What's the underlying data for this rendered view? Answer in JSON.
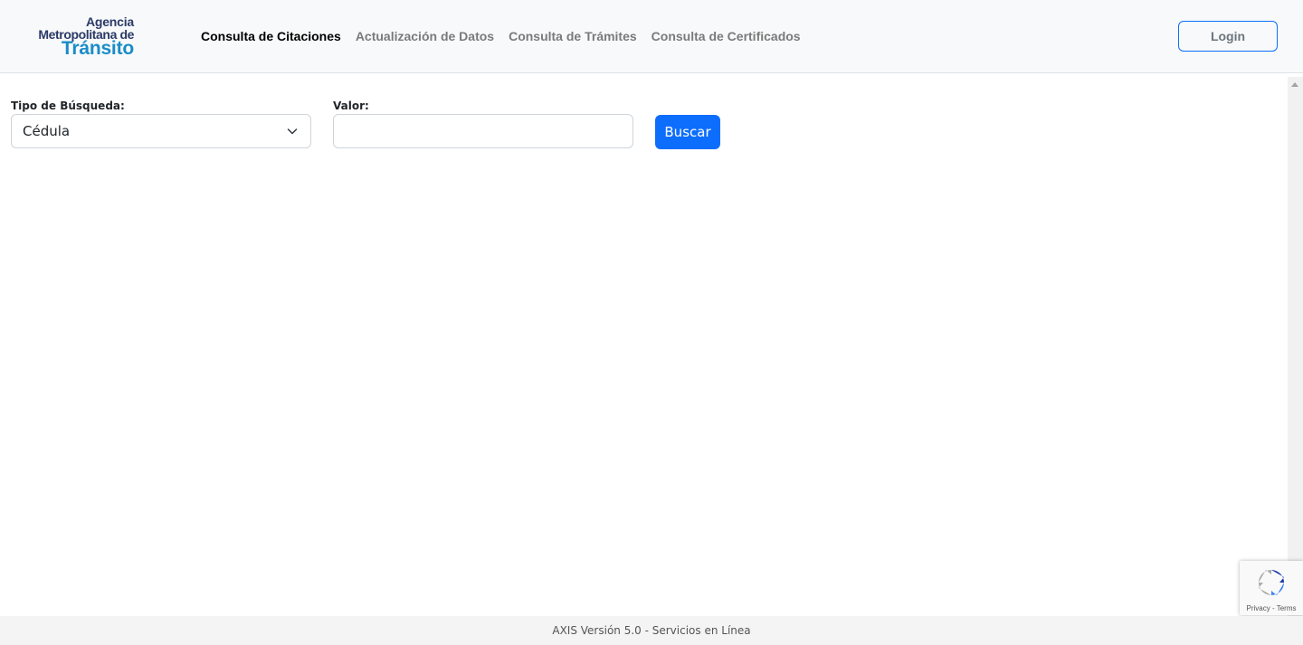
{
  "header": {
    "logo": {
      "line1": "Agencia",
      "line2": "Metropolitana de",
      "line3": "Tránsito"
    },
    "nav": [
      {
        "label": "Consulta de Citaciones",
        "active": true
      },
      {
        "label": "Actualización de Datos",
        "active": false
      },
      {
        "label": "Consulta de Trámites",
        "active": false
      },
      {
        "label": "Consulta de Certificados",
        "active": false
      }
    ],
    "login_label": "Login"
  },
  "form": {
    "search_type_label": "Tipo de Búsqueda:",
    "search_type_value": "Cédula",
    "value_label": "Valor:",
    "value_input": "",
    "submit_label": "Buscar"
  },
  "recaptcha": {
    "privacy": "Privacy",
    "separator": " - ",
    "terms": "Terms"
  },
  "footer": {
    "text": "AXIS Versión 5.0 - Servicios en Línea"
  },
  "colors": {
    "primary": "#0d6efd",
    "logo_dark": "#2b3a67",
    "logo_blue": "#1a8cc8",
    "nav_inactive": "#7a7a7a"
  }
}
